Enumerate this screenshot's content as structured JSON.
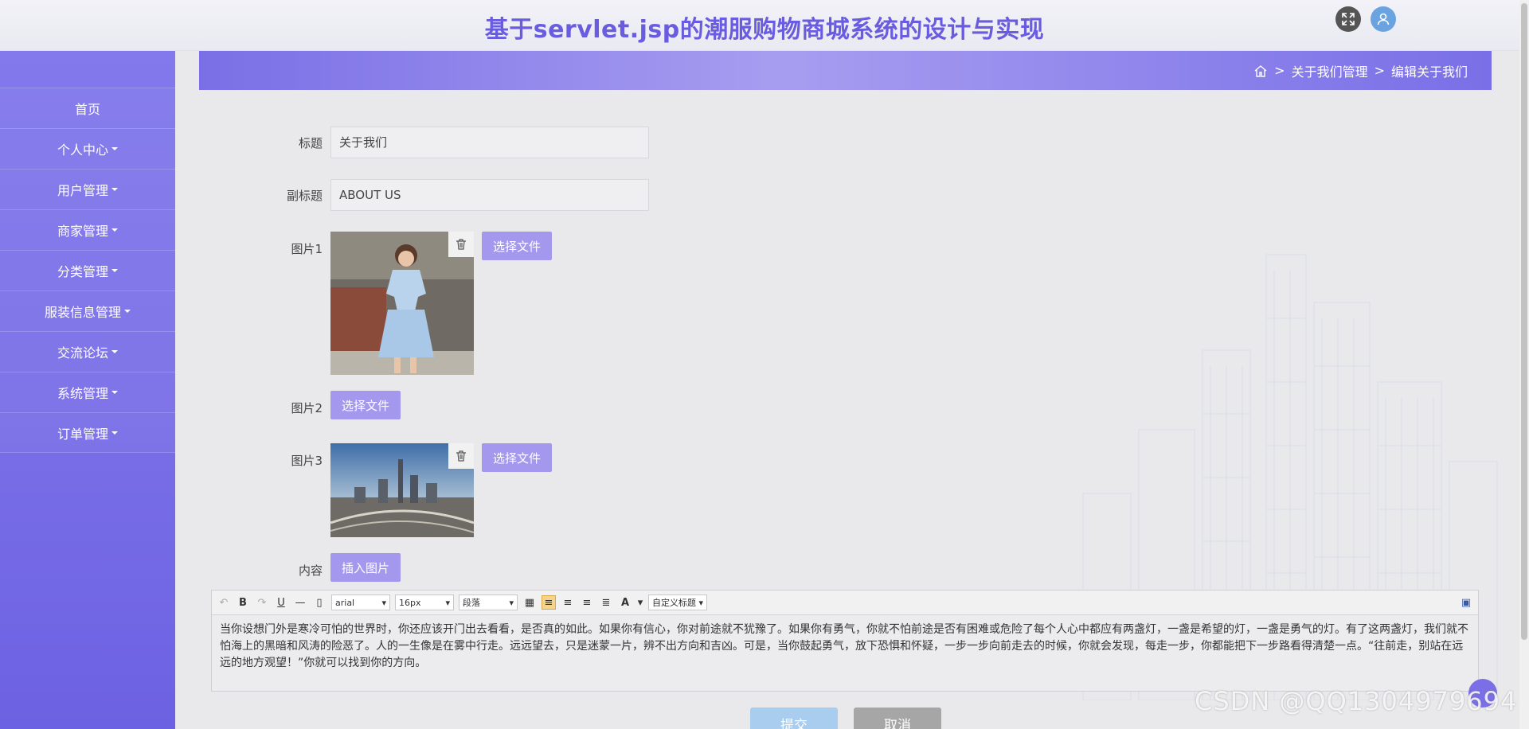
{
  "header": {
    "title": "基于servlet.jsp的潮服购物商城系统的设计与实现"
  },
  "sidebar": {
    "items": [
      {
        "label": "首页",
        "has_caret": false
      },
      {
        "label": "个人中心",
        "has_caret": true
      },
      {
        "label": "用户管理",
        "has_caret": true
      },
      {
        "label": "商家管理",
        "has_caret": true
      },
      {
        "label": "分类管理",
        "has_caret": true
      },
      {
        "label": "服装信息管理",
        "has_caret": true
      },
      {
        "label": "交流论坛",
        "has_caret": true
      },
      {
        "label": "系统管理",
        "has_caret": true
      },
      {
        "label": "订单管理",
        "has_caret": true
      }
    ]
  },
  "breadcrumb": {
    "separator": ">",
    "items": [
      "关于我们管理",
      "编辑关于我们"
    ]
  },
  "form": {
    "title_label": "标题",
    "title_value": "关于我们",
    "subtitle_label": "副标题",
    "subtitle_value": "ABOUT US",
    "image1_label": "图片1",
    "image2_label": "图片2",
    "image3_label": "图片3",
    "content_label": "内容",
    "choose_file": "选择文件",
    "insert_image": "插入图片"
  },
  "editor": {
    "font_family": "arial",
    "font_size": "16px",
    "paragraph": "段落",
    "custom_heading": "自定义标题",
    "content": "当你设想门外是寒冷可怕的世界时，你还应该开门出去看看，是否真的如此。如果你有信心，你对前途就不犹豫了。如果你有勇气，你就不怕前途是否有困难或危险了每个人心中都应有两盏灯，一盏是希望的灯，一盏是勇气的灯。有了这两盏灯，我们就不怕海上的黑暗和风涛的险恶了。人的一生像是在雾中行走。远远望去，只是迷蒙一片，辨不出方向和吉凶。可是，当你鼓起勇气，放下恐惧和怀疑，一步一步向前走去的时候，你就会发现，每走一步，你都能把下一步路看得清楚一点。“往前走，别站在远远的地方观望！”你就可以找到你的方向。"
  },
  "actions": {
    "submit": "提交",
    "cancel": "取消"
  },
  "watermark": "CSDN @QQ1304979694",
  "colors": {
    "accent": "#6a5ce0",
    "sidebar": "#7b70e8",
    "file_button": "#a397ee"
  }
}
